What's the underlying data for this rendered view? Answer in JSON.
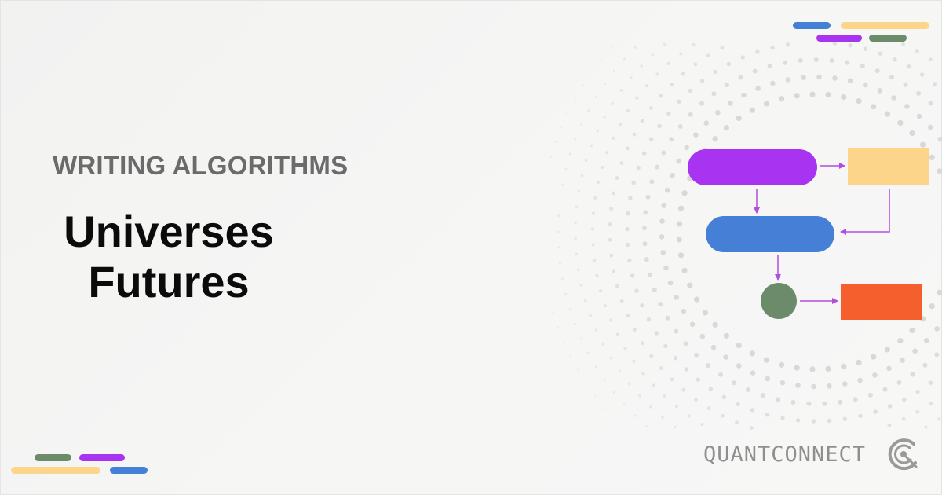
{
  "header": {
    "kicker": "WRITING ALGORITHMS"
  },
  "title": {
    "line1": "Universes",
    "line2": "Futures"
  },
  "brand": {
    "name": "QUANTCONNECT"
  },
  "colors": {
    "purple": "#a833f0",
    "yellow": "#fdd58a",
    "blue": "#4580d6",
    "green": "#6b8b6a",
    "orange": "#f55e2d",
    "arrow": "#b34ce0",
    "dots": "#d2d2d2"
  },
  "icons": {
    "logo": "quantconnect-logo-icon"
  }
}
